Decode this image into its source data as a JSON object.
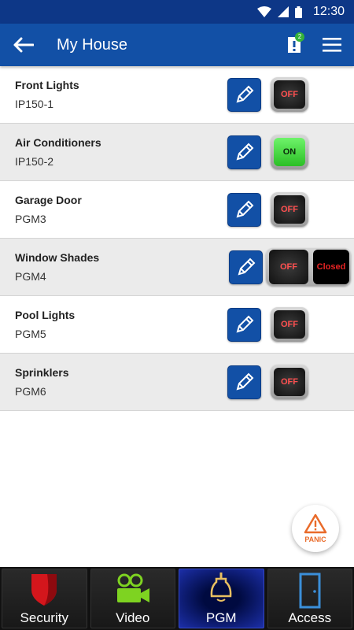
{
  "status_bar": {
    "time": "12:30"
  },
  "app_bar": {
    "title": "My House",
    "notification_count": "2"
  },
  "devices": [
    {
      "name": "Front Lights",
      "sub": "IP150-1",
      "state": "OFF"
    },
    {
      "name": "Air Conditioners",
      "sub": "IP150-2",
      "state": "ON"
    },
    {
      "name": "Garage Door",
      "sub": "PGM3",
      "state": "OFF"
    },
    {
      "name": "Window Shades",
      "sub": "PGM4",
      "state": "OFF",
      "extra": "Closed"
    },
    {
      "name": "Pool Lights",
      "sub": "PGM5",
      "state": "OFF"
    },
    {
      "name": "Sprinklers",
      "sub": "PGM6",
      "state": "OFF"
    }
  ],
  "panic": {
    "label": "PANIC"
  },
  "bottom_nav": [
    {
      "label": "Security",
      "icon": "shield-icon"
    },
    {
      "label": "Video",
      "icon": "video-camera-icon"
    },
    {
      "label": "PGM",
      "icon": "light-bulb-icon",
      "active": true
    },
    {
      "label": "Access",
      "icon": "door-icon"
    }
  ],
  "colors": {
    "header_dark": "#0d3787",
    "header": "#1250a6",
    "on_green": "#2bbf25",
    "off_red": "#ff5050",
    "panic_orange": "#e96b2a",
    "nav_active": "#1c2fa8"
  }
}
